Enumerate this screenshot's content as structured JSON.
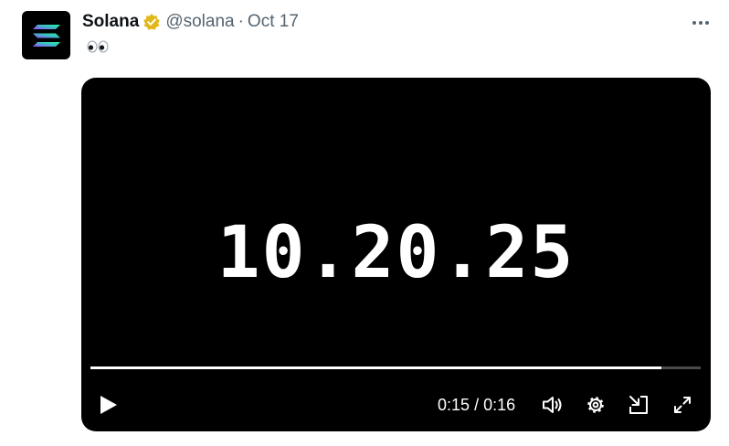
{
  "tweet": {
    "author_name": "Solana",
    "handle": "@solana",
    "separator": "·",
    "date": "Oct 17",
    "text": "👀",
    "more_icon": "more-horizontal-icon",
    "verified_icon": "verified-badge-icon",
    "verified_color": "#e2b719"
  },
  "video": {
    "title_text": "10.20.25",
    "current_time": "0:15",
    "time_separator": "/",
    "duration": "0:16",
    "progress_fraction": 0.936,
    "controls": [
      "play-icon",
      "volume-icon",
      "settings-icon",
      "pop-out-icon",
      "fullscreen-icon"
    ]
  }
}
